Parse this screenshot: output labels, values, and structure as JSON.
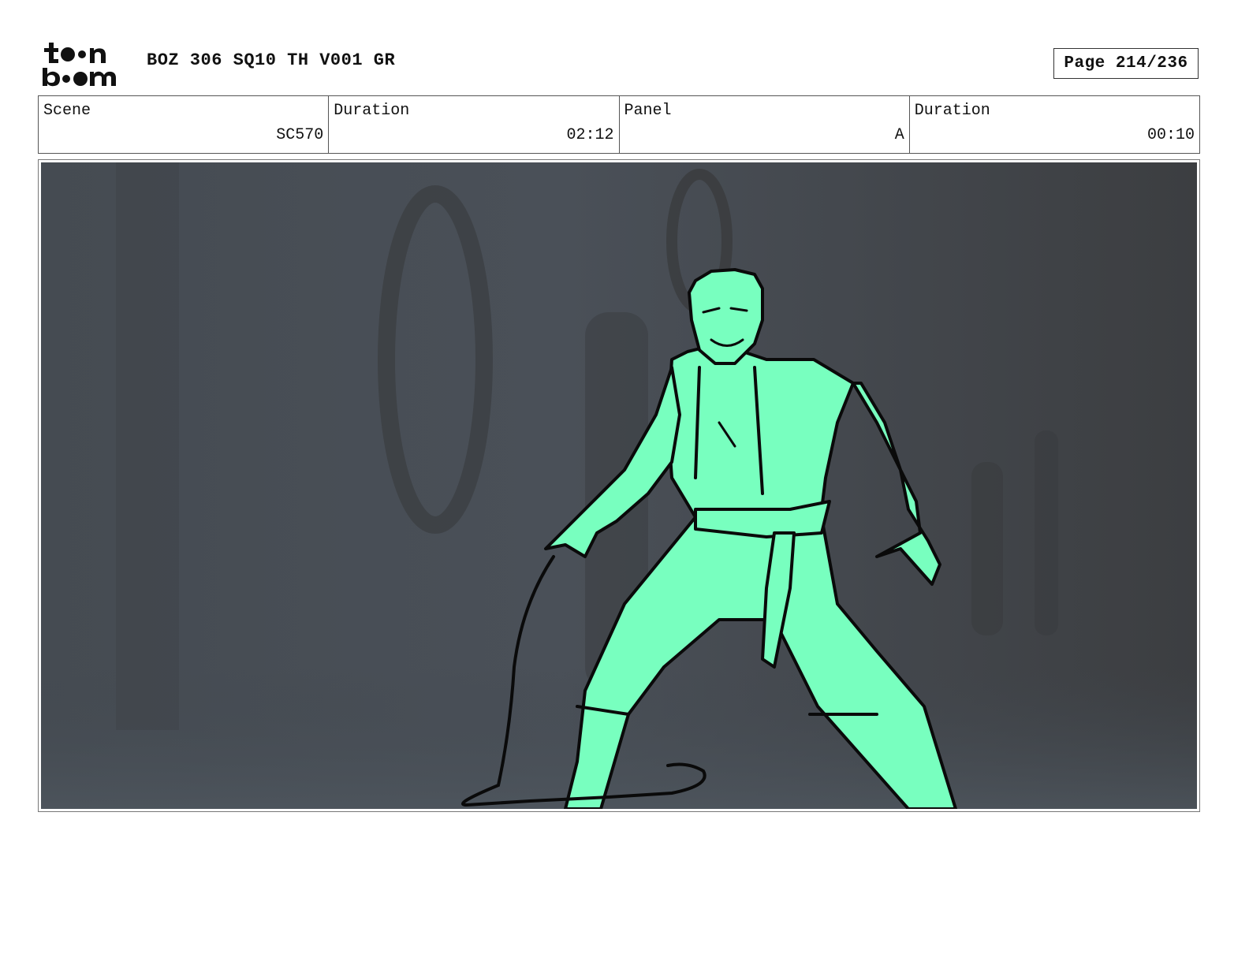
{
  "header": {
    "logo_text": "toon boom",
    "title": "BOZ 306 SQ10 TH V001 GR",
    "page_label": "Page 214/236"
  },
  "info": {
    "scene_label": "Scene",
    "scene_value": "SC570",
    "scene_duration_label": "Duration",
    "scene_duration_value": "02:12",
    "panel_label": "Panel",
    "panel_value": "A",
    "panel_duration_label": "Duration",
    "panel_duration_value": "00:10"
  },
  "colors": {
    "character_fill": "#78ffbf",
    "background_dark": "#3f4347",
    "line": "#0a0a0a"
  },
  "icons": {
    "logo": "toon-boom-logo"
  }
}
